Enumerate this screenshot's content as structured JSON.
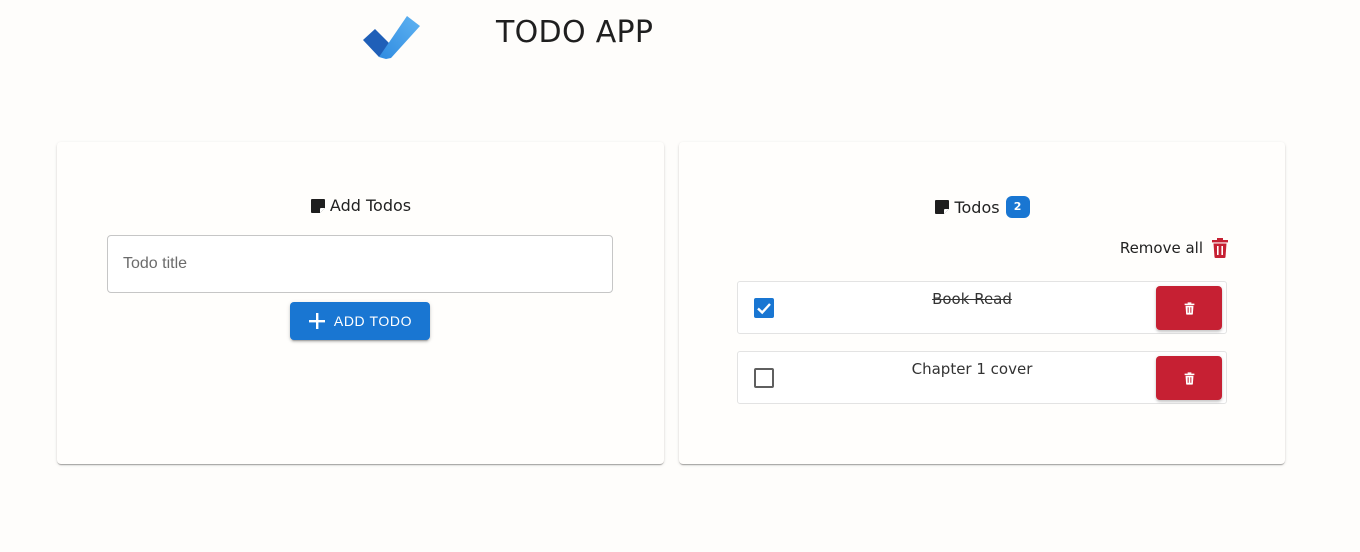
{
  "header": {
    "title": "TODO APP",
    "logo_icon": "check-logo-icon"
  },
  "add_panel": {
    "heading": "Add Todos",
    "heading_icon": "sticky-note-icon",
    "input": {
      "placeholder": "Todo title",
      "value": ""
    },
    "add_button_label": "ADD TODO",
    "add_button_icon": "plus-icon"
  },
  "list_panel": {
    "heading": "Todos",
    "heading_icon": "sticky-note-icon",
    "count": "2",
    "remove_all_label": "Remove all",
    "remove_all_icon": "trash-icon",
    "todos": [
      {
        "title": "Book Read",
        "completed": true
      },
      {
        "title": "Chapter 1 cover",
        "completed": false
      }
    ]
  },
  "colors": {
    "primary": "#1976d2",
    "danger": "#c62033",
    "background": "#fefdfb"
  }
}
